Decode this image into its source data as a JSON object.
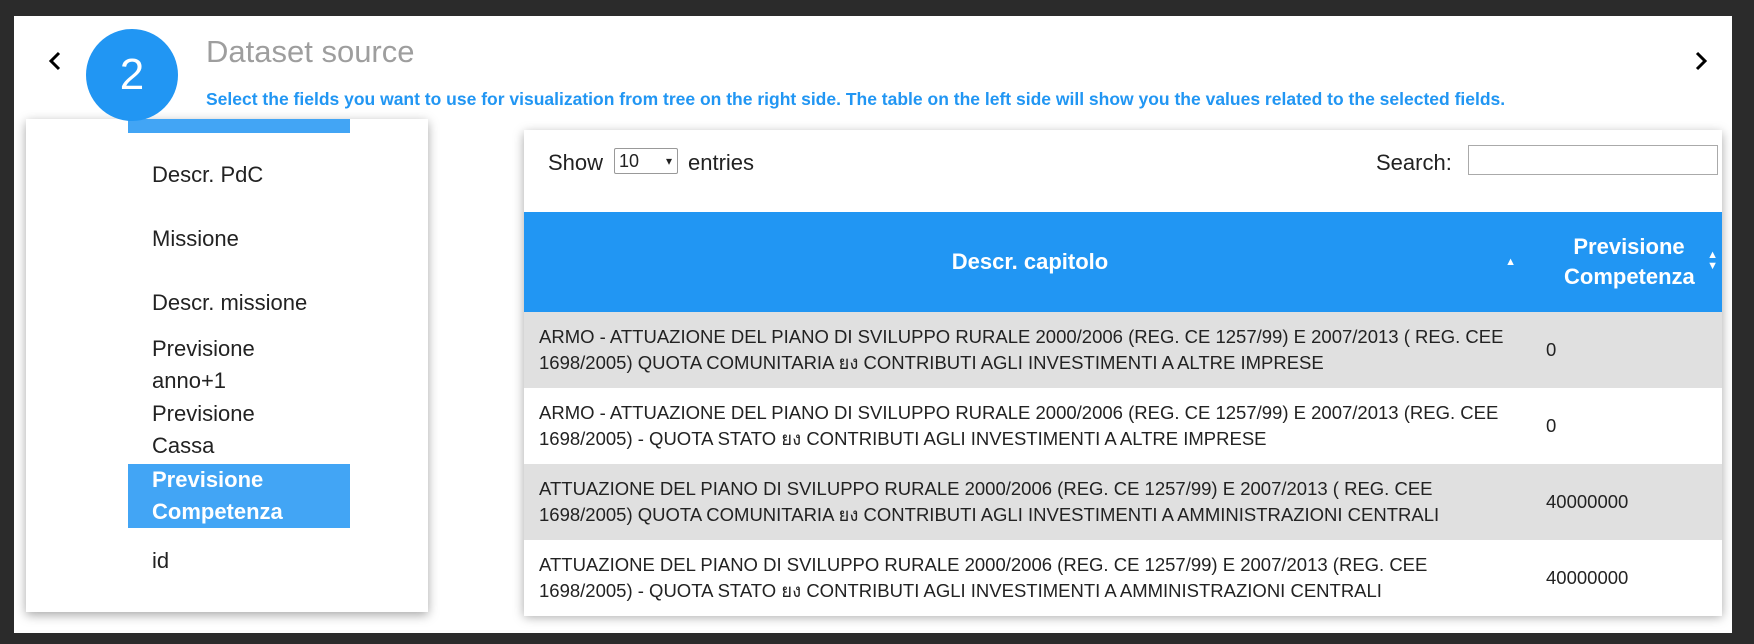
{
  "step": {
    "number": "2",
    "title": "Dataset source",
    "subtitle": "Select the fields you want to use for visualization from tree on the right side. The table on the left side will show you the values related to the selected fields."
  },
  "tree": {
    "items": [
      {
        "label": "Descr. PdC"
      },
      {
        "label": "Missione"
      },
      {
        "label": "Descr. missione"
      },
      {
        "label": "Previsione anno+1"
      },
      {
        "label": "Previsione Cassa"
      },
      {
        "label": "Previsione Competenza",
        "selected": true
      },
      {
        "label": "id"
      }
    ]
  },
  "table_controls": {
    "show_label": "Show",
    "entries_value": "10",
    "entries_label": "entries",
    "search_label": "Search:",
    "search_value": ""
  },
  "table": {
    "headers": [
      "Descr. capitolo",
      "Previsione Competenza"
    ],
    "rows": [
      {
        "descr": "ARMO - ATTUAZIONE DEL PIANO DI SVILUPPO RURALE 2000/2006 (REG. CE 1257/99) E 2007/2013 ( REG. CEE 1698/2005) QUOTA COMUNITARIA ยง CONTRIBUTI AGLI INVESTIMENTI A ALTRE IMPRESE",
        "value": "0"
      },
      {
        "descr": "ARMO - ATTUAZIONE DEL PIANO DI SVILUPPO RURALE 2000/2006 (REG. CE 1257/99) E 2007/2013 (REG. CEE 1698/2005) - QUOTA STATO ยง CONTRIBUTI AGLI INVESTIMENTI A ALTRE IMPRESE",
        "value": "0"
      },
      {
        "descr": "ATTUAZIONE DEL PIANO DI SVILUPPO RURALE 2000/2006 (REG. CE 1257/99) E 2007/2013 ( REG. CEE 1698/2005) QUOTA COMUNITARIA ยง CONTRIBUTI AGLI INVESTIMENTI A AMMINISTRAZIONI CENTRALI",
        "value": "40000000"
      },
      {
        "descr": "ATTUAZIONE DEL PIANO DI SVILUPPO RURALE 2000/2006 (REG. CE 1257/99) E 2007/2013 (REG. CEE 1698/2005) - QUOTA STATO ยง CONTRIBUTI AGLI INVESTIMENTI A AMMINISTRAZIONI CENTRALI",
        "value": "40000000"
      }
    ]
  },
  "colors": {
    "accent": "#2196f3",
    "selected_item": "#42a5f5",
    "row_stripe": "#e0e0e0"
  }
}
